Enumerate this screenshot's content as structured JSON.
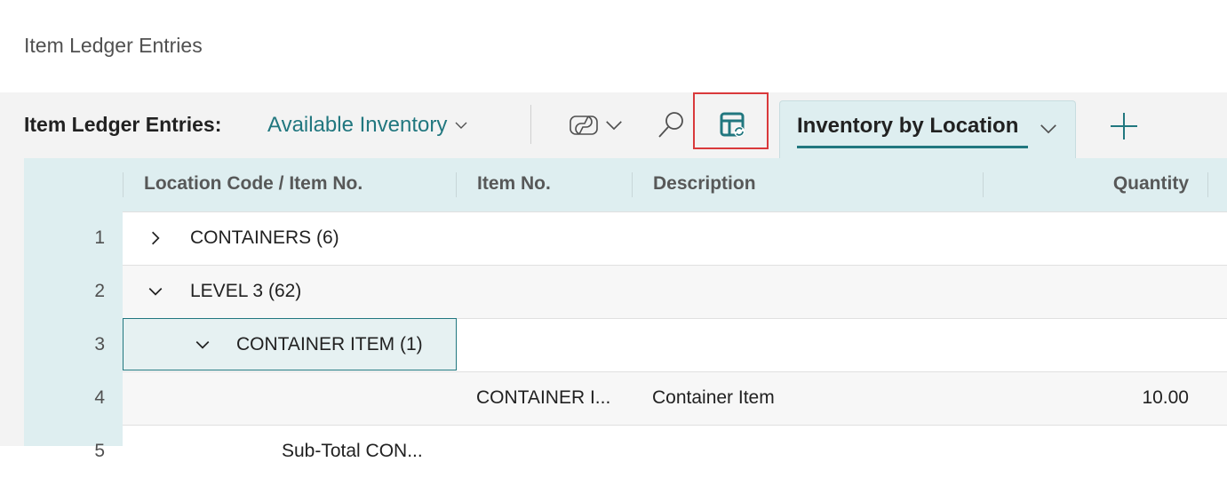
{
  "page": {
    "title": "Item Ledger Entries"
  },
  "toolbar": {
    "caption": "Item Ledger Entries:",
    "view_name": "Available Inventory",
    "icons": [
      "copilot-icon",
      "chevron-down-icon",
      "search-icon",
      "analysis-mode-icon",
      "add-icon"
    ],
    "tab_label": "Inventory by Location"
  },
  "grid": {
    "columns": [
      "Location Code / Item No.",
      "Item No.",
      "Description",
      "Quantity"
    ],
    "rows": [
      {
        "num": "1",
        "group": "CONTAINERS (6)",
        "expanded": false
      },
      {
        "num": "2",
        "group": "LEVEL 3 (62)",
        "expanded": true
      },
      {
        "num": "3",
        "group": "CONTAINER ITEM (1)",
        "expanded": true
      },
      {
        "num": "4",
        "item_no": "CONTAINER I...",
        "description": "Container Item",
        "quantity": "10.00"
      },
      {
        "num": "5",
        "group": "Sub-Total CON..."
      }
    ]
  },
  "colors": {
    "accent": "#21777f",
    "header_bg": "#deeef0",
    "highlight": "#d9393b"
  }
}
